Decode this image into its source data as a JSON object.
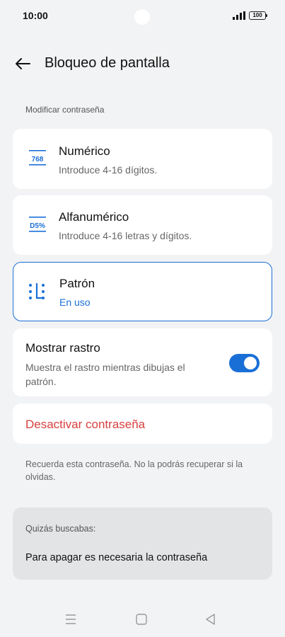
{
  "status_bar": {
    "time": "10:00",
    "battery": "100"
  },
  "header": {
    "title": "Bloqueo de pantalla"
  },
  "section_label": "Modificar contraseña",
  "options": [
    {
      "title": "Numérico",
      "subtitle": "Introduce 4-16 dígitos.",
      "icon_text": "768",
      "icon": "numeric-password-icon"
    },
    {
      "title": "Alfanumérico",
      "subtitle": "Introduce 4-16 letras y dígitos.",
      "icon_text": "D5%",
      "icon": "alphanumeric-password-icon"
    },
    {
      "title": "Patrón",
      "subtitle": "En uso",
      "icon": "pattern-icon",
      "selected": true
    }
  ],
  "show_trace": {
    "title": "Mostrar rastro",
    "description": "Muestra el rastro mientras dibujas el patrón.",
    "enabled": true
  },
  "disable_password": {
    "label": "Desactivar contraseña"
  },
  "note": "Recuerda esta contraseña. No la podrás recuperar si la olvidas.",
  "suggestions": {
    "label": "Quizás buscabas:",
    "item": "Para apagar es necesaria la contraseña"
  },
  "colors": {
    "accent": "#1a6fd6",
    "danger": "#d6403f",
    "background": "#f2f3f5"
  }
}
